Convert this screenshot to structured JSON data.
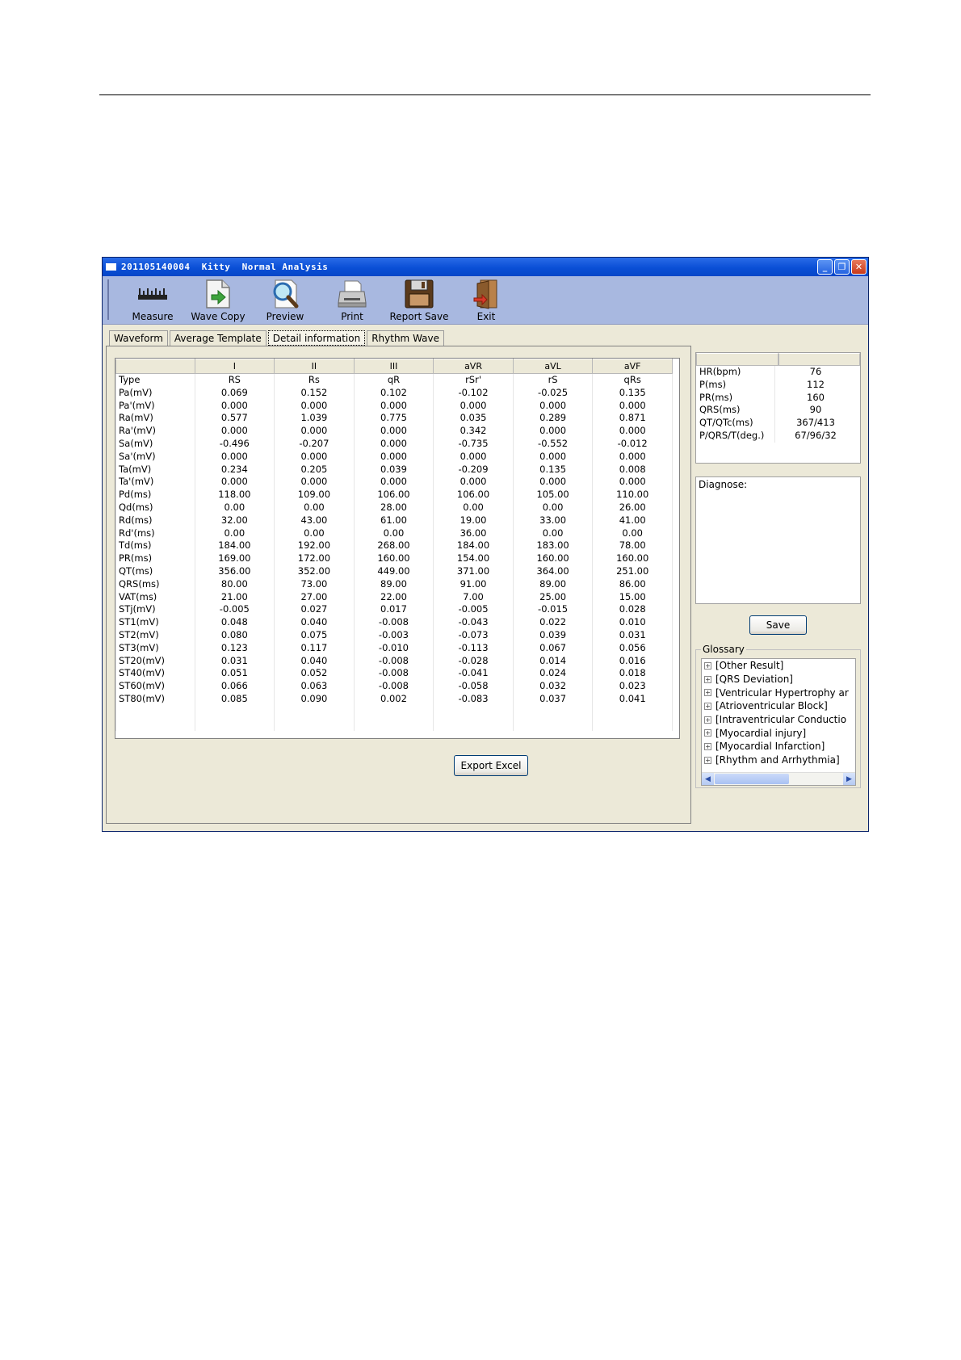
{
  "window": {
    "title": "201105140004  Kitty  Normal Analysis"
  },
  "toolbar": {
    "items": [
      {
        "label": "Measure",
        "icon": "ruler-icon"
      },
      {
        "label": "Wave Copy",
        "icon": "document-arrow-icon"
      },
      {
        "label": "Preview",
        "icon": "magnifier-icon"
      },
      {
        "label": "Print",
        "icon": "printer-icon"
      },
      {
        "label": "Report Save",
        "icon": "floppy-disk-icon"
      },
      {
        "label": "Exit",
        "icon": "exit-door-icon"
      }
    ]
  },
  "tabs": [
    {
      "label": "Waveform",
      "active": false
    },
    {
      "label": "Average Template",
      "active": false
    },
    {
      "label": "Detail information",
      "active": true
    },
    {
      "label": "Rhythm Wave",
      "active": false
    }
  ],
  "grid": {
    "columns": [
      "I",
      "II",
      "III",
      "aVR",
      "aVL",
      "aVF"
    ],
    "rows": [
      {
        "label": "Type",
        "values": [
          "RS",
          "Rs",
          "qR",
          "rSr'",
          "rS",
          "qRs"
        ]
      },
      {
        "label": "Pa(mV)",
        "values": [
          "0.069",
          "0.152",
          "0.102",
          "-0.102",
          "-0.025",
          "0.135"
        ]
      },
      {
        "label": "Pa'(mV)",
        "values": [
          "0.000",
          "0.000",
          "0.000",
          "0.000",
          "0.000",
          "0.000"
        ]
      },
      {
        "label": "Ra(mV)",
        "values": [
          "0.577",
          "1.039",
          "0.775",
          "0.035",
          "0.289",
          "0.871"
        ]
      },
      {
        "label": "Ra'(mV)",
        "values": [
          "0.000",
          "0.000",
          "0.000",
          "0.342",
          "0.000",
          "0.000"
        ]
      },
      {
        "label": "Sa(mV)",
        "values": [
          "-0.496",
          "-0.207",
          "0.000",
          "-0.735",
          "-0.552",
          "-0.012"
        ]
      },
      {
        "label": "Sa'(mV)",
        "values": [
          "0.000",
          "0.000",
          "0.000",
          "0.000",
          "0.000",
          "0.000"
        ]
      },
      {
        "label": "Ta(mV)",
        "values": [
          "0.234",
          "0.205",
          "0.039",
          "-0.209",
          "0.135",
          "0.008"
        ]
      },
      {
        "label": "Ta'(mV)",
        "values": [
          "0.000",
          "0.000",
          "0.000",
          "0.000",
          "0.000",
          "0.000"
        ]
      },
      {
        "label": "Pd(ms)",
        "values": [
          "118.00",
          "109.00",
          "106.00",
          "106.00",
          "105.00",
          "110.00"
        ]
      },
      {
        "label": "Qd(ms)",
        "values": [
          "0.00",
          "0.00",
          "28.00",
          "0.00",
          "0.00",
          "26.00"
        ]
      },
      {
        "label": "Rd(ms)",
        "values": [
          "32.00",
          "43.00",
          "61.00",
          "19.00",
          "33.00",
          "41.00"
        ]
      },
      {
        "label": "Rd'(ms)",
        "values": [
          "0.00",
          "0.00",
          "0.00",
          "36.00",
          "0.00",
          "0.00"
        ]
      },
      {
        "label": "Td(ms)",
        "values": [
          "184.00",
          "192.00",
          "268.00",
          "184.00",
          "183.00",
          "78.00"
        ]
      },
      {
        "label": "PR(ms)",
        "values": [
          "169.00",
          "172.00",
          "160.00",
          "154.00",
          "160.00",
          "160.00"
        ]
      },
      {
        "label": "QT(ms)",
        "values": [
          "356.00",
          "352.00",
          "449.00",
          "371.00",
          "364.00",
          "251.00"
        ]
      },
      {
        "label": "QRS(ms)",
        "values": [
          "80.00",
          "73.00",
          "89.00",
          "91.00",
          "89.00",
          "86.00"
        ]
      },
      {
        "label": "VAT(ms)",
        "values": [
          "21.00",
          "27.00",
          "22.00",
          "7.00",
          "25.00",
          "15.00"
        ]
      },
      {
        "label": "STj(mV)",
        "values": [
          "-0.005",
          "0.027",
          "0.017",
          "-0.005",
          "-0.015",
          "0.028"
        ]
      },
      {
        "label": "ST1(mV)",
        "values": [
          "0.048",
          "0.040",
          "-0.008",
          "-0.043",
          "0.022",
          "0.010"
        ]
      },
      {
        "label": "ST2(mV)",
        "values": [
          "0.080",
          "0.075",
          "-0.003",
          "-0.073",
          "0.039",
          "0.031"
        ]
      },
      {
        "label": "ST3(mV)",
        "values": [
          "0.123",
          "0.117",
          "-0.010",
          "-0.113",
          "0.067",
          "0.056"
        ]
      },
      {
        "label": "ST20(mV)",
        "values": [
          "0.031",
          "0.040",
          "-0.008",
          "-0.028",
          "0.014",
          "0.016"
        ]
      },
      {
        "label": "ST40(mV)",
        "values": [
          "0.051",
          "0.052",
          "-0.008",
          "-0.041",
          "0.024",
          "0.018"
        ]
      },
      {
        "label": "ST60(mV)",
        "values": [
          "0.066",
          "0.063",
          "-0.008",
          "-0.058",
          "0.032",
          "0.023"
        ]
      },
      {
        "label": "ST80(mV)",
        "values": [
          "0.085",
          "0.090",
          "0.002",
          "-0.083",
          "0.037",
          "0.041"
        ]
      }
    ]
  },
  "export_label": "Export Excel",
  "summary": [
    {
      "label": "HR(bpm)",
      "value": "76"
    },
    {
      "label": "P(ms)",
      "value": "112"
    },
    {
      "label": "PR(ms)",
      "value": "160"
    },
    {
      "label": "QRS(ms)",
      "value": "90"
    },
    {
      "label": "QT/QTc(ms)",
      "value": "367/413"
    },
    {
      "label": "P/QRS/T(deg.)",
      "value": "67/96/32"
    }
  ],
  "diagnose_label": "Diagnose:",
  "save_label": "Save",
  "glossary": {
    "title": "Glossary",
    "items": [
      "[Other Result]",
      "[QRS Deviation]",
      "[Ventricular Hypertrophy ar",
      "[Atrioventricular Block]",
      "[Intraventricular Conductio",
      "[Myocardial injury]",
      "[Myocardial Infarction]",
      "[Rhythm and Arrhythmia]"
    ]
  }
}
